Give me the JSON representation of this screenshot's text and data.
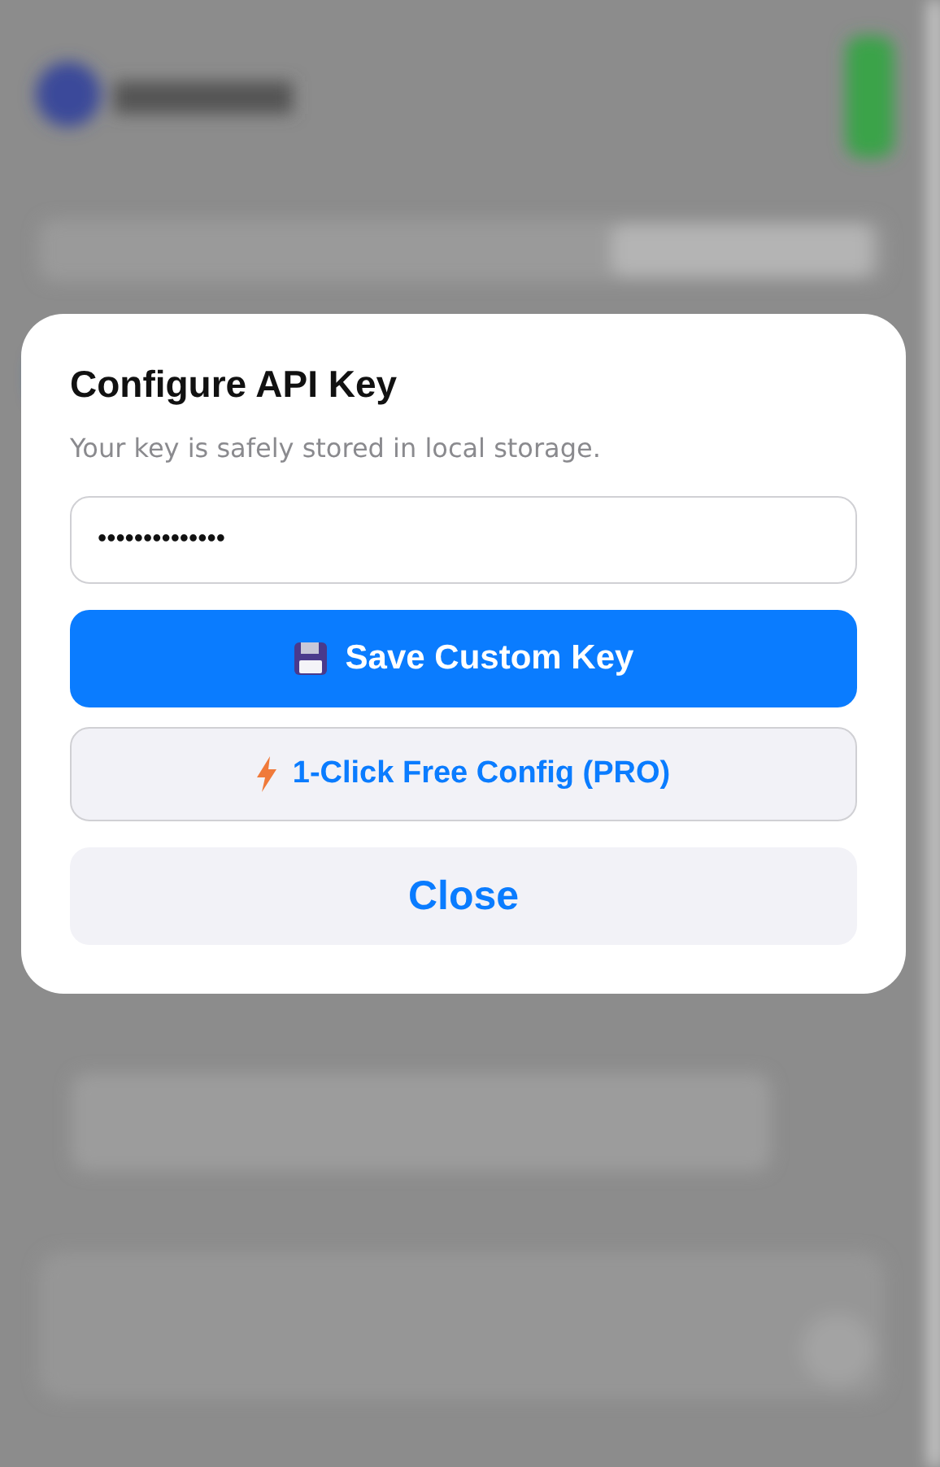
{
  "dialog": {
    "title": "Configure API Key",
    "subtitle": "Your key is safely stored in local storage.",
    "key_field": {
      "value": "••••••••••••••"
    },
    "buttons": [
      {
        "kind": "primary",
        "label": "Save Custom Key"
      },
      {
        "kind": "secondary",
        "label": "1-Click Free Config (PRO)"
      },
      {
        "kind": "plain",
        "label": "Close"
      }
    ]
  }
}
